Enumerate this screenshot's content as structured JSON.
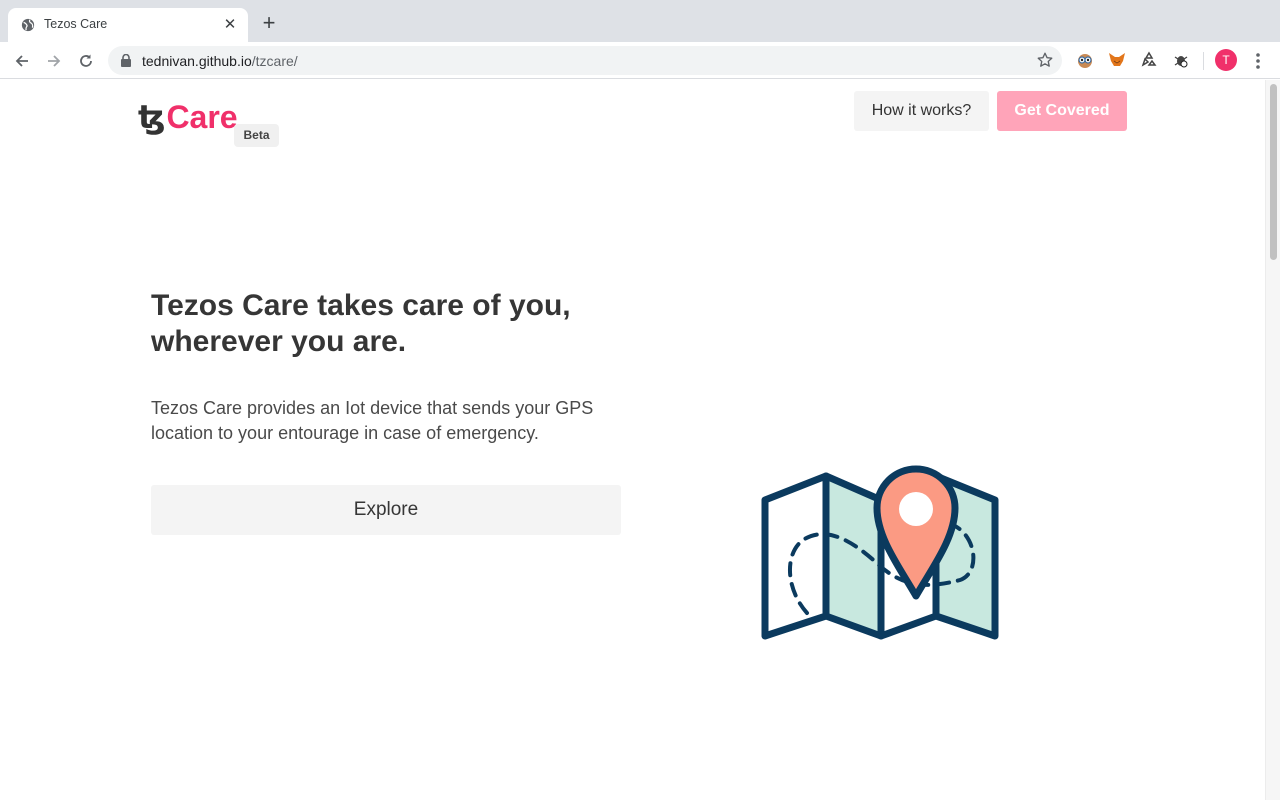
{
  "browser": {
    "tab_title": "Tezos Care",
    "url_host": "tednivan.github.io",
    "url_path": "/tzcare/",
    "profile_initial": "T"
  },
  "header": {
    "logo_tz": "ꜩ",
    "logo_care": "Care",
    "beta_badge": "Beta",
    "how_label": "How it works?",
    "cover_label": "Get Covered"
  },
  "hero": {
    "headline_line1": "Tezos Care takes care of you,",
    "headline_line2": "wherever you are.",
    "description": "Tezos Care provides an Iot device that sends your GPS location to your entourage in case of emergency.",
    "explore_label": "Explore"
  },
  "colors": {
    "brand_pink": "#f0306a",
    "cover_button": "#ffa4b9",
    "map_outline": "#0b3a5e",
    "map_fill": "#c8e8df",
    "pin_fill": "#fb9a83"
  },
  "icons": [
    "globe-icon",
    "close-icon",
    "plus-icon",
    "back-arrow-icon",
    "forward-arrow-icon",
    "reload-icon",
    "lock-icon",
    "star-icon",
    "extension-icons",
    "menu-dots-icon",
    "map-pin-illustration"
  ]
}
